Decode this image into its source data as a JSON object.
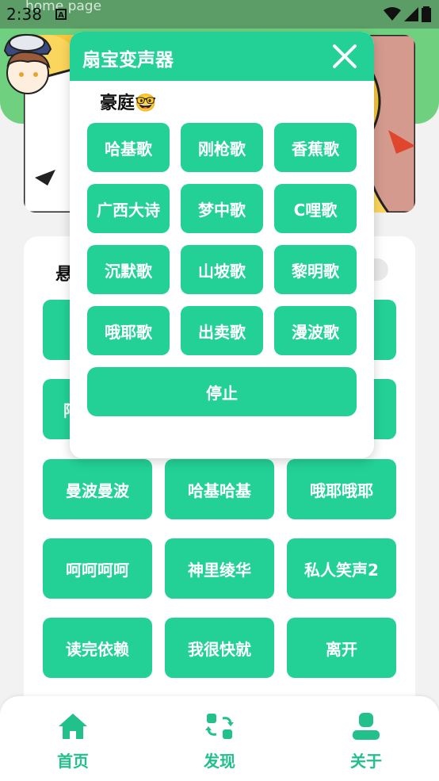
{
  "status": {
    "time": "2:38",
    "app_title": "home page",
    "notif_letter": "A"
  },
  "card": {
    "label": "悬"
  },
  "grid": {
    "row1": [
      "",
      "",
      ""
    ],
    "row2": [
      "阿",
      "",
      ""
    ],
    "row3": [
      "曼波曼波",
      "哈基哈基",
      "哦耶哦耶"
    ],
    "row4": [
      "呵呵呵呵",
      "神里绫华",
      "私人笑声2"
    ],
    "row5": [
      "读完依赖",
      "我很快就",
      "离开"
    ]
  },
  "dialog": {
    "title": "扇宝变声器",
    "subtitle": "豪庭🤓",
    "buttons": [
      "哈基歌",
      "刚枪歌",
      "香蕉歌",
      "广西大诗",
      "梦中歌",
      "C哩歌",
      "沉默歌",
      "山坡歌",
      "黎明歌",
      "哦耶歌",
      "出卖歌",
      "漫波歌"
    ],
    "stop": "停止"
  },
  "nav": {
    "home": "首页",
    "discover": "发现",
    "about": "关于"
  },
  "colors": {
    "accent": "#23d196",
    "header_green": "#6fd07f",
    "banner_yellow": "#f8c63a"
  }
}
